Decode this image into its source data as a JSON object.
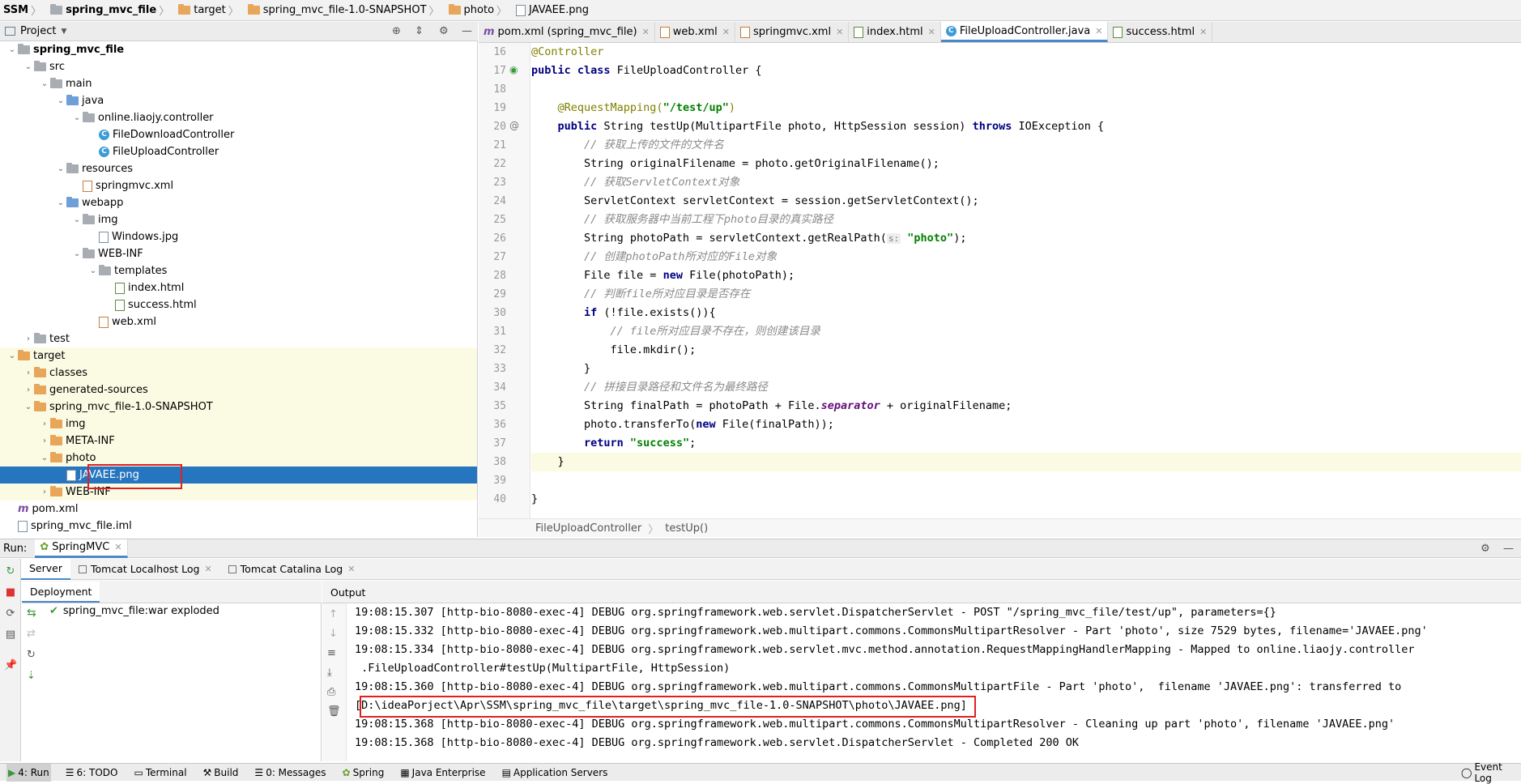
{
  "breadcrumb": [
    "SSM",
    "spring_mvc_file",
    "target",
    "spring_mvc_file-1.0-SNAPSHOT",
    "photo",
    "JAVAEE.png"
  ],
  "project_panel": {
    "title": "Project"
  },
  "tree": [
    {
      "label": "spring_mvc_file",
      "type": "module",
      "level": 1,
      "open": true,
      "bold": true
    },
    {
      "label": "src",
      "type": "folder",
      "level": 2,
      "open": true
    },
    {
      "label": "main",
      "type": "folder",
      "level": 3,
      "open": true
    },
    {
      "label": "java",
      "type": "folder-blue",
      "level": 4,
      "open": true
    },
    {
      "label": "online.liaojy.controller",
      "type": "package",
      "level": 5,
      "open": true
    },
    {
      "label": "FileDownloadController",
      "type": "class",
      "level": 6
    },
    {
      "label": "FileUploadController",
      "type": "class",
      "level": 6
    },
    {
      "label": "resources",
      "type": "folder",
      "level": 4,
      "open": true
    },
    {
      "label": "springmvc.xml",
      "type": "xml",
      "level": 5
    },
    {
      "label": "webapp",
      "type": "folder-blue",
      "level": 4,
      "open": true
    },
    {
      "label": "img",
      "type": "folder",
      "level": 5,
      "open": true
    },
    {
      "label": "Windows.jpg",
      "type": "png",
      "level": 6
    },
    {
      "label": "WEB-INF",
      "type": "folder",
      "level": 5,
      "open": true
    },
    {
      "label": "templates",
      "type": "folder",
      "level": 6,
      "open": true
    },
    {
      "label": "index.html",
      "type": "html",
      "level": 7
    },
    {
      "label": "success.html",
      "type": "html",
      "level": 7
    },
    {
      "label": "web.xml",
      "type": "xml",
      "level": 6
    },
    {
      "label": "test",
      "type": "folder",
      "level": 2,
      "open": false
    },
    {
      "label": "target",
      "type": "folder-orange",
      "level": 1,
      "open": true,
      "hl": true
    },
    {
      "label": "classes",
      "type": "folder-orange",
      "level": 2,
      "open": false,
      "hl": true
    },
    {
      "label": "generated-sources",
      "type": "folder-orange",
      "level": 2,
      "open": false,
      "hl": true
    },
    {
      "label": "spring_mvc_file-1.0-SNAPSHOT",
      "type": "folder-orange",
      "level": 2,
      "open": true,
      "hl": true
    },
    {
      "label": "img",
      "type": "folder-orange",
      "level": 3,
      "open": false,
      "hl": true
    },
    {
      "label": "META-INF",
      "type": "folder-orange",
      "level": 3,
      "open": false,
      "hl": true
    },
    {
      "label": "photo",
      "type": "folder-orange",
      "level": 3,
      "open": true,
      "hl": true
    },
    {
      "label": "JAVAEE.png",
      "type": "png",
      "level": 4,
      "sel": true
    },
    {
      "label": "WEB-INF",
      "type": "folder-orange",
      "level": 3,
      "open": false,
      "hl": true
    },
    {
      "label": "pom.xml",
      "type": "maven",
      "level": 1
    },
    {
      "label": "spring_mvc_file.iml",
      "type": "iml",
      "level": 1
    }
  ],
  "tabs": [
    {
      "label": "pom.xml (spring_mvc_file)",
      "icon": "maven-icon"
    },
    {
      "label": "web.xml",
      "icon": "xml-icon"
    },
    {
      "label": "springmvc.xml",
      "icon": "xml-icon"
    },
    {
      "label": "index.html",
      "icon": "html-icon"
    },
    {
      "label": "FileUploadController.java",
      "icon": "class-icon",
      "active": true
    },
    {
      "label": "success.html",
      "icon": "html-icon"
    }
  ],
  "line_numbers": [
    "16",
    "17",
    "18",
    "19",
    "20",
    "21",
    "22",
    "23",
    "24",
    "25",
    "26",
    "27",
    "28",
    "29",
    "30",
    "31",
    "32",
    "33",
    "34",
    "35",
    "36",
    "37",
    "38",
    "39",
    "40"
  ],
  "editor_breadcrumb": [
    "FileUploadController",
    "testUp()"
  ],
  "code": {
    "l16": "@Controller",
    "l17a": "public class",
    "l17b": " FileUploadController {",
    "l19a": "    @RequestMapping(",
    "l19b": "\"/test/up\"",
    "l19c": ")",
    "l20a": "    public",
    "l20b": " String testUp(MultipartFile photo, HttpSession session) ",
    "l20c": "throws",
    "l20d": " IOException {",
    "l21": "        // 获取上传的文件的文件名",
    "l22": "        String originalFilename = photo.getOriginalFilename();",
    "l23": "        // 获取ServletContext对象",
    "l24": "        ServletContext servletContext = session.getServletContext();",
    "l25": "        // 获取服务器中当前工程下photo目录的真实路径",
    "l26a": "        String photoPath = servletContext.getRealPath(",
    "l26h": "s:",
    "l26b": " \"photo\"",
    "l26c": ");",
    "l27": "        // 创建photoPath所对应的File对象",
    "l28a": "        File file = ",
    "l28b": "new",
    "l28c": " File(photoPath);",
    "l29": "        // 判断file所对应目录是否存在",
    "l30a": "        if",
    "l30b": " (!file.exists()){",
    "l31": "            // file所对应目录不存在，则创建该目录",
    "l32": "            file.mkdir();",
    "l33": "        }",
    "l34": "        // 拼接目录路径和文件名为最终路径",
    "l35a": "        String finalPath = photoPath + File.",
    "l35b": "separator",
    "l35c": " + originalFilename;",
    "l36a": "        photo.transferTo(",
    "l36b": "new",
    "l36c": " File(finalPath));",
    "l37a": "        return",
    "l37b": " \"success\"",
    "l37c": ";",
    "l38": "    }",
    "l40": "}"
  },
  "run": {
    "label": "Run:",
    "config": "SpringMVC",
    "subtabs": [
      "Server",
      "Tomcat Localhost Log",
      "Tomcat Catalina Log"
    ],
    "deployment_header": "Deployment",
    "output_header": "Output",
    "deployment_item": "spring_mvc_file:war exploded",
    "output": [
      "19:08:15.307 [http-bio-8080-exec-4] DEBUG org.springframework.web.servlet.DispatcherServlet - POST \"/spring_mvc_file/test/up\", parameters={}",
      "19:08:15.332 [http-bio-8080-exec-4] DEBUG org.springframework.web.multipart.commons.CommonsMultipartResolver - Part 'photo', size 7529 bytes, filename='JAVAEE.png'",
      "19:08:15.334 [http-bio-8080-exec-4] DEBUG org.springframework.web.servlet.mvc.method.annotation.RequestMappingHandlerMapping - Mapped to online.liaojy.controller",
      " .FileUploadController#testUp(MultipartFile, HttpSession)",
      "19:08:15.360 [http-bio-8080-exec-4] DEBUG org.springframework.web.multipart.commons.CommonsMultipartFile - Part 'photo',  filename 'JAVAEE.png': transferred to",
      "[D:\\ideaPorject\\Apr\\SSM\\spring_mvc_file\\target\\spring_mvc_file-1.0-SNAPSHOT\\photo\\JAVAEE.png]",
      "19:08:15.368 [http-bio-8080-exec-4] DEBUG org.springframework.web.multipart.commons.CommonsMultipartResolver - Cleaning up part 'photo', filename 'JAVAEE.png'",
      "19:08:15.368 [http-bio-8080-exec-4] DEBUG org.springframework.web.servlet.DispatcherServlet - Completed 200 OK"
    ]
  },
  "bottom_tools": [
    "4: Run",
    "6: TODO",
    "Terminal",
    "Build",
    "0: Messages",
    "Spring",
    "Java Enterprise",
    "Application Servers"
  ],
  "event_log": "Event Log",
  "colors": {
    "selection": "#2675bf",
    "highlight": "#fbfbe4",
    "redbox": "#e02020",
    "tab_accent": "#4a88c7"
  }
}
